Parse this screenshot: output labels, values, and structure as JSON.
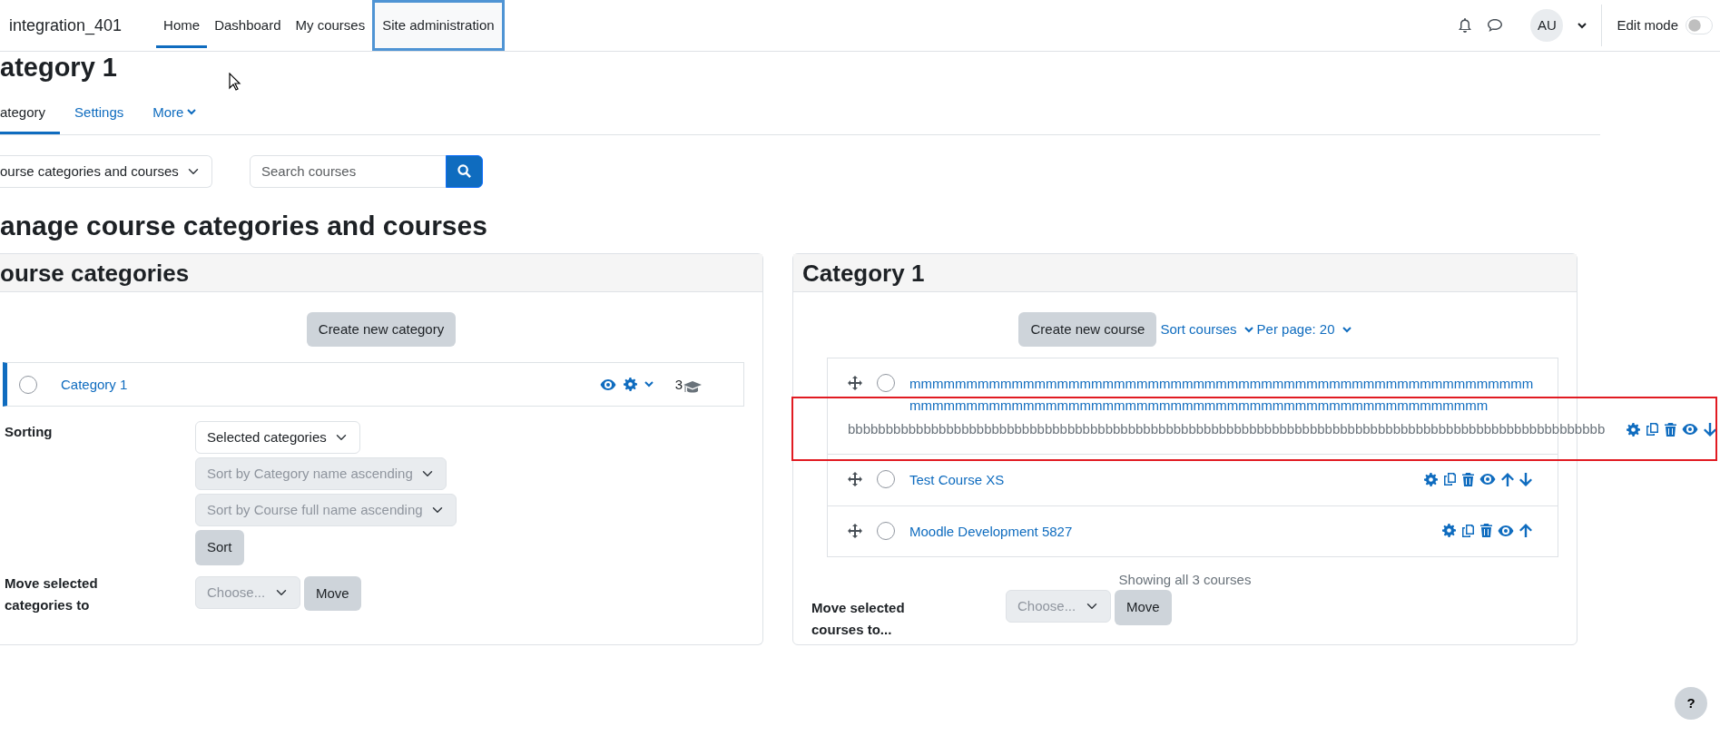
{
  "site_name": "integration_401",
  "primary_nav": [
    {
      "label": "Home",
      "selected": true,
      "focused": false
    },
    {
      "label": "Dashboard",
      "selected": false,
      "focused": false
    },
    {
      "label": "My courses",
      "selected": false,
      "focused": false
    },
    {
      "label": "Site administration",
      "selected": false,
      "focused": true
    }
  ],
  "user": {
    "initials": "AU"
  },
  "edit_mode": {
    "label": "Edit mode",
    "on": false
  },
  "page_heading": "ategory 1",
  "secondary_nav": [
    {
      "label": "ategory",
      "selected": true,
      "dropdown": false
    },
    {
      "label": "Settings",
      "selected": false,
      "dropdown": false
    },
    {
      "label": "More",
      "selected": false,
      "dropdown": true
    }
  ],
  "view_select": {
    "value": "ourse categories and courses"
  },
  "search": {
    "placeholder": "Search courses"
  },
  "title": "anage course categories and courses",
  "categories_panel": {
    "heading": "ourse categories",
    "create_button": "Create new category",
    "categories": [
      {
        "name": "Category 1",
        "selected": true,
        "checked": false,
        "course_count": "3"
      }
    ],
    "sorting": {
      "label": "Sorting",
      "scope": {
        "value": "Selected categories",
        "disabled": false
      },
      "options": [
        {
          "value": "Sort by Category name ascending",
          "disabled": true
        },
        {
          "value": "Sort by Course full name ascending",
          "disabled": true
        }
      ],
      "button": "Sort"
    },
    "move": {
      "label": "Move selected categories to",
      "select": {
        "value": "Choose...",
        "disabled": true
      },
      "button": "Move"
    }
  },
  "courses_panel": {
    "heading": "Category 1",
    "create_button": "Create new course",
    "sort_link": "Sort courses",
    "per_page_link": "Per page: 20",
    "courses": [
      {
        "name": "mmmmmmmmmmmmmmmmmmmmmmmmmmmmmmmmmmmmmmmmmmmmmmmmmmmmmmmmmmmmmmmmmmmmmmmmmmmmmmmmmmmmmmmmmmmmmmmmmmmmmmmmmm",
        "detail": "bbbbbbbbbbbbbbbbbbbbbbbbbbbbbbbbbbbbbbbbbbbbbbbbbbbbbbbbbbbbbbbbbbbbbbbbbbbbbbbbbbbbbbbbbbbbbbbbbbbb",
        "checked": false,
        "highlighted": true,
        "actions": [
          {
            "kind": "edit"
          },
          {
            "kind": "copy"
          },
          {
            "kind": "delete"
          },
          {
            "kind": "hide"
          },
          {
            "kind": "movedown"
          }
        ]
      },
      {
        "name": "Test Course XS",
        "checked": false,
        "highlighted": false,
        "actions": [
          {
            "kind": "edit"
          },
          {
            "kind": "copy"
          },
          {
            "kind": "delete"
          },
          {
            "kind": "hide"
          },
          {
            "kind": "moveup"
          },
          {
            "kind": "movedown"
          }
        ]
      },
      {
        "name": "Moodle Development 5827",
        "checked": false,
        "highlighted": false,
        "actions": [
          {
            "kind": "edit"
          },
          {
            "kind": "copy"
          },
          {
            "kind": "delete"
          },
          {
            "kind": "hide"
          },
          {
            "kind": "moveup"
          }
        ]
      }
    ],
    "summary": "Showing all 3 courses",
    "move": {
      "label": "Move selected courses to...",
      "select": {
        "value": "Choose...",
        "disabled": true
      },
      "button": "Move"
    }
  },
  "help_button": "?"
}
